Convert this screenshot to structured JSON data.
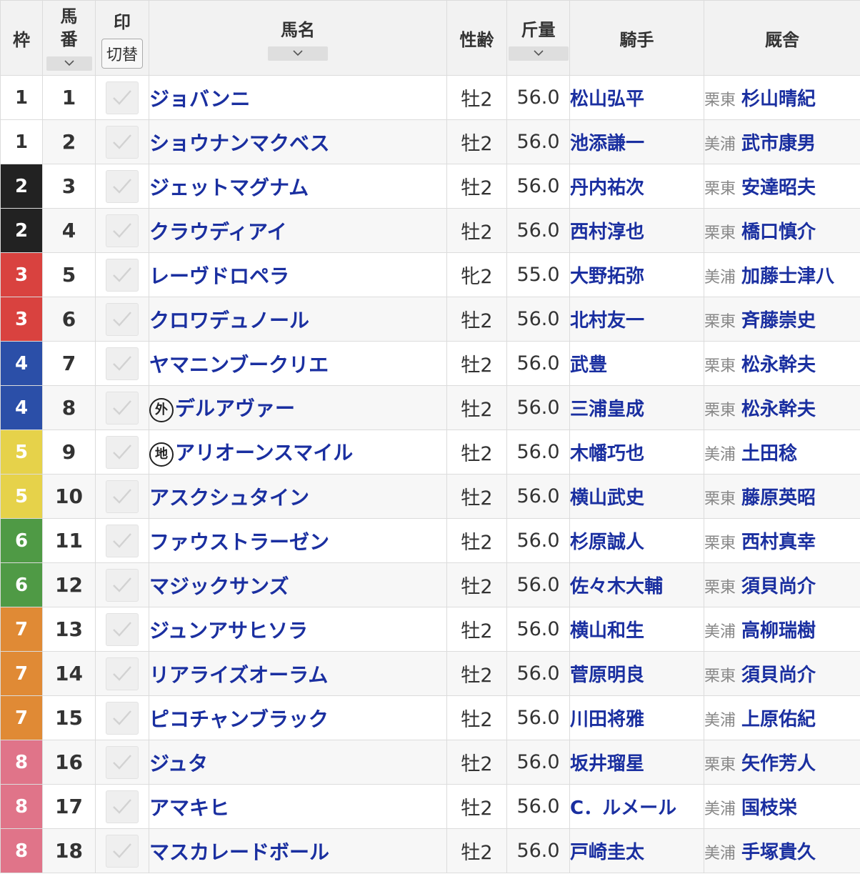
{
  "header": {
    "waku": "枠",
    "umaban_line1": "馬",
    "umaban_line2": "番",
    "mark": "印",
    "mark_toggle": "切替",
    "horse_name": "馬名",
    "sex_age": "性齢",
    "weight": "斤量",
    "jockey": "騎手",
    "stable": "厩舎"
  },
  "waku_colors": {
    "1": {
      "bg": "#ffffff",
      "fg": "#333333"
    },
    "2": {
      "bg": "#222222",
      "fg": "#ffffff"
    },
    "3": {
      "bg": "#d9423f",
      "fg": "#ffffff"
    },
    "4": {
      "bg": "#2b4fa8",
      "fg": "#ffffff"
    },
    "5": {
      "bg": "#e6d24a",
      "fg": "#ffffff"
    },
    "6": {
      "bg": "#4f9a45",
      "fg": "#ffffff"
    },
    "7": {
      "bg": "#e08a35",
      "fg": "#ffffff"
    },
    "8": {
      "bg": "#e07489",
      "fg": "#ffffff"
    }
  },
  "rows": [
    {
      "waku": "1",
      "umaban": "1",
      "prefix": "",
      "horse": "ジョバンニ",
      "sex_age": "牡2",
      "weight": "56.0",
      "jockey": "松山弘平",
      "region": "栗東",
      "trainer": "杉山晴紀"
    },
    {
      "waku": "1",
      "umaban": "2",
      "prefix": "",
      "horse": "ショウナンマクベス",
      "sex_age": "牡2",
      "weight": "56.0",
      "jockey": "池添謙一",
      "region": "美浦",
      "trainer": "武市康男"
    },
    {
      "waku": "2",
      "umaban": "3",
      "prefix": "",
      "horse": "ジェットマグナム",
      "sex_age": "牡2",
      "weight": "56.0",
      "jockey": "丹内祐次",
      "region": "栗東",
      "trainer": "安達昭夫"
    },
    {
      "waku": "2",
      "umaban": "4",
      "prefix": "",
      "horse": "クラウディアイ",
      "sex_age": "牡2",
      "weight": "56.0",
      "jockey": "西村淳也",
      "region": "栗東",
      "trainer": "橋口慎介"
    },
    {
      "waku": "3",
      "umaban": "5",
      "prefix": "",
      "horse": "レーヴドロペラ",
      "sex_age": "牝2",
      "weight": "55.0",
      "jockey": "大野拓弥",
      "region": "美浦",
      "trainer": "加藤士津八"
    },
    {
      "waku": "3",
      "umaban": "6",
      "prefix": "",
      "horse": "クロワデュノール",
      "sex_age": "牡2",
      "weight": "56.0",
      "jockey": "北村友一",
      "region": "栗東",
      "trainer": "斉藤崇史"
    },
    {
      "waku": "4",
      "umaban": "7",
      "prefix": "",
      "horse": "ヤマニンブークリエ",
      "sex_age": "牡2",
      "weight": "56.0",
      "jockey": "武豊",
      "region": "栗東",
      "trainer": "松永幹夫"
    },
    {
      "waku": "4",
      "umaban": "8",
      "prefix": "外",
      "horse": "デルアヴァー",
      "sex_age": "牡2",
      "weight": "56.0",
      "jockey": "三浦皇成",
      "region": "栗東",
      "trainer": "松永幹夫"
    },
    {
      "waku": "5",
      "umaban": "9",
      "prefix": "地",
      "horse": "アリオーンスマイル",
      "sex_age": "牡2",
      "weight": "56.0",
      "jockey": "木幡巧也",
      "region": "美浦",
      "trainer": "土田稔"
    },
    {
      "waku": "5",
      "umaban": "10",
      "prefix": "",
      "horse": "アスクシュタイン",
      "sex_age": "牡2",
      "weight": "56.0",
      "jockey": "横山武史",
      "region": "栗東",
      "trainer": "藤原英昭"
    },
    {
      "waku": "6",
      "umaban": "11",
      "prefix": "",
      "horse": "ファウストラーゼン",
      "sex_age": "牡2",
      "weight": "56.0",
      "jockey": "杉原誠人",
      "region": "栗東",
      "trainer": "西村真幸"
    },
    {
      "waku": "6",
      "umaban": "12",
      "prefix": "",
      "horse": "マジックサンズ",
      "sex_age": "牡2",
      "weight": "56.0",
      "jockey": "佐々木大輔",
      "region": "栗東",
      "trainer": "須貝尚介"
    },
    {
      "waku": "7",
      "umaban": "13",
      "prefix": "",
      "horse": "ジュンアサヒソラ",
      "sex_age": "牡2",
      "weight": "56.0",
      "jockey": "横山和生",
      "region": "美浦",
      "trainer": "高柳瑞樹"
    },
    {
      "waku": "7",
      "umaban": "14",
      "prefix": "",
      "horse": "リアライズオーラム",
      "sex_age": "牡2",
      "weight": "56.0",
      "jockey": "菅原明良",
      "region": "栗東",
      "trainer": "須貝尚介"
    },
    {
      "waku": "7",
      "umaban": "15",
      "prefix": "",
      "horse": "ピコチャンブラック",
      "sex_age": "牡2",
      "weight": "56.0",
      "jockey": "川田将雅",
      "region": "美浦",
      "trainer": "上原佑紀"
    },
    {
      "waku": "8",
      "umaban": "16",
      "prefix": "",
      "horse": "ジュタ",
      "sex_age": "牡2",
      "weight": "56.0",
      "jockey": "坂井瑠星",
      "region": "栗東",
      "trainer": "矢作芳人"
    },
    {
      "waku": "8",
      "umaban": "17",
      "prefix": "",
      "horse": "アマキヒ",
      "sex_age": "牡2",
      "weight": "56.0",
      "jockey": "C．ルメール",
      "region": "美浦",
      "trainer": "国枝栄"
    },
    {
      "waku": "8",
      "umaban": "18",
      "prefix": "",
      "horse": "マスカレードボール",
      "sex_age": "牡2",
      "weight": "56.0",
      "jockey": "戸崎圭太",
      "region": "美浦",
      "trainer": "手塚貴久"
    }
  ]
}
